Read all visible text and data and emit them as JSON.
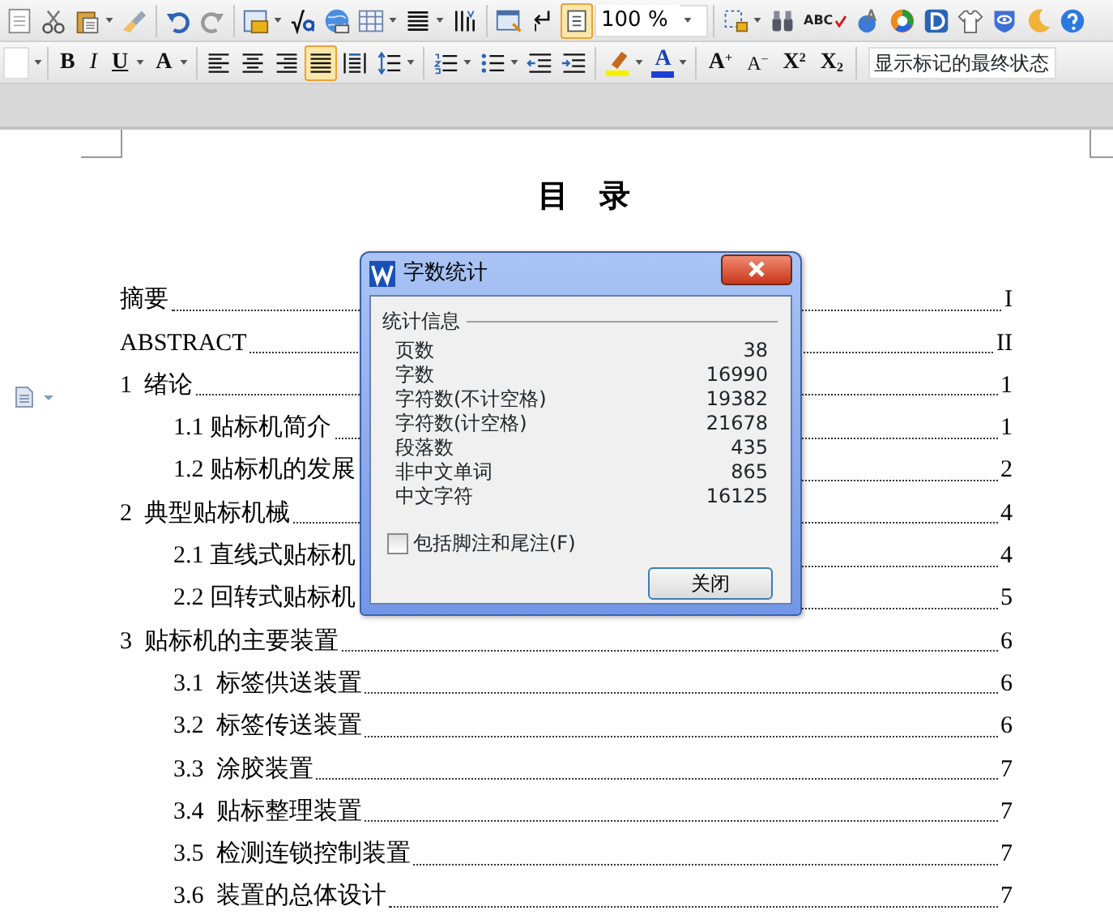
{
  "toolbar_1": {
    "items": [
      {
        "kind": "page-cut",
        "selected": false,
        "caret": false
      },
      {
        "kind": "scissors",
        "selected": false,
        "caret": false
      },
      {
        "kind": "paste",
        "selected": false,
        "caret": true
      },
      {
        "kind": "brush",
        "selected": false,
        "caret": false
      },
      {
        "kind": "undo",
        "selected": false,
        "caret": false
      },
      {
        "kind": "redo",
        "selected": false,
        "caret": false
      },
      {
        "kind": "table-yellow",
        "selected": false,
        "caret": true
      },
      {
        "kind": "formula",
        "selected": false,
        "caret": false
      },
      {
        "kind": "globe",
        "selected": false,
        "caret": false
      },
      {
        "kind": "table",
        "selected": false,
        "caret": true
      },
      {
        "kind": "columns",
        "selected": false,
        "caret": true
      },
      {
        "kind": "text-bars",
        "selected": false,
        "caret": false
      },
      {
        "kind": "doc-pen",
        "selected": false,
        "caret": false
      },
      {
        "kind": "return",
        "selected": false,
        "caret": false
      },
      {
        "kind": "page",
        "selected": true,
        "caret": false
      },
      {
        "kind": "zoom-field",
        "value": "100 %"
      },
      {
        "kind": "select-frame",
        "selected": false,
        "caret": true
      },
      {
        "kind": "binoculars",
        "selected": false,
        "caret": false
      },
      {
        "kind": "spellcheck",
        "label": "ABC",
        "selected": false,
        "caret": false
      },
      {
        "kind": "globe-a",
        "selected": false,
        "caret": false
      },
      {
        "kind": "color-ring",
        "selected": false,
        "caret": false
      },
      {
        "kind": "blue-d",
        "selected": false,
        "caret": false
      },
      {
        "kind": "shirt",
        "selected": false,
        "caret": false
      },
      {
        "kind": "shield",
        "selected": false,
        "caret": false
      },
      {
        "kind": "moon",
        "selected": false,
        "caret": false
      },
      {
        "kind": "help",
        "selected": false,
        "caret": false
      }
    ]
  },
  "toolbar_2": {
    "items": [
      {
        "kind": "size-field"
      },
      {
        "kind": "bold",
        "label": "B",
        "selected": false,
        "caret": false
      },
      {
        "kind": "italic",
        "label": "I",
        "selected": false,
        "caret": false
      },
      {
        "kind": "underline",
        "label": "U",
        "selected": false,
        "caret": true
      },
      {
        "kind": "effects",
        "label": "A",
        "selected": false,
        "caret": true
      },
      {
        "kind": "align-left",
        "selected": false,
        "caret": false
      },
      {
        "kind": "align-center",
        "selected": false,
        "caret": false
      },
      {
        "kind": "align-right",
        "selected": false,
        "caret": false
      },
      {
        "kind": "align-justify",
        "selected": true,
        "caret": false
      },
      {
        "kind": "distribute",
        "selected": false,
        "caret": false
      },
      {
        "kind": "line-spacing",
        "selected": false,
        "caret": true
      },
      {
        "kind": "numbered-list",
        "selected": false,
        "caret": true
      },
      {
        "kind": "bullet-list",
        "selected": false,
        "caret": true
      },
      {
        "kind": "outdent",
        "selected": false,
        "caret": false
      },
      {
        "kind": "indent",
        "selected": false,
        "caret": false
      },
      {
        "kind": "highlight",
        "selected": false,
        "caret": true
      },
      {
        "kind": "font-color",
        "label": "A",
        "selected": false,
        "caret": true
      },
      {
        "kind": "grow",
        "label": "A$^{+}$",
        "selected": false,
        "caret": false
      },
      {
        "kind": "shrink",
        "label": "A$^{−}$",
        "selected": false,
        "caret": false
      },
      {
        "kind": "superscript",
        "label": "X$^{2}$",
        "selected": false,
        "caret": false
      },
      {
        "kind": "subscript",
        "label": "X$_{2}$",
        "selected": false,
        "caret": false
      },
      {
        "kind": "markup-field",
        "value": "显示标记的最终状态"
      }
    ]
  },
  "document": {
    "heading": "目　录",
    "toc": [
      {
        "title": "摘要",
        "page": "I"
      },
      {
        "title": "ABSTRACT",
        "page": "II"
      },
      {
        "title": "1  绪论",
        "page": "1",
        "children": [
          {
            "title": "1.1 贴标机简介",
            "page": "1"
          },
          {
            "title": "1.2 贴标机的发展",
            "page": "2"
          }
        ]
      },
      {
        "title": "2  典型贴标机械",
        "page": "4",
        "children": [
          {
            "title": "2.1 直线式贴标机",
            "page": "4"
          },
          {
            "title": "2.2 回转式贴标机",
            "page": "5"
          }
        ]
      },
      {
        "title": "3  贴标机的主要装置",
        "page": "6",
        "children": [
          {
            "title": "3.1  标签供送装置",
            "page": "6"
          },
          {
            "title": "3.2  标签传送装置",
            "page": "6"
          },
          {
            "title": "3.3  涂胶装置",
            "page": "7"
          },
          {
            "title": "3.4  贴标整理装置",
            "page": "7"
          },
          {
            "title": "3.5  检测连锁控制装置",
            "page": "7"
          },
          {
            "title": "3.6  装置的总体设计",
            "page": "7"
          }
        ]
      }
    ]
  },
  "dialog": {
    "title": "字数统计",
    "group": "统计信息",
    "stats": [
      {
        "label": "页数",
        "value": "38"
      },
      {
        "label": "字数",
        "value": "16990"
      },
      {
        "label": "字符数(不计空格)",
        "value": "19382"
      },
      {
        "label": "字符数(计空格)",
        "value": "21678"
      },
      {
        "label": "段落数",
        "value": "435"
      },
      {
        "label": "非中文单词",
        "value": "865"
      },
      {
        "label": "中文字符",
        "value": "16125"
      }
    ],
    "checkbox": {
      "label": "包括脚注和尾注(F)",
      "checked": false
    },
    "button": "关闭"
  }
}
